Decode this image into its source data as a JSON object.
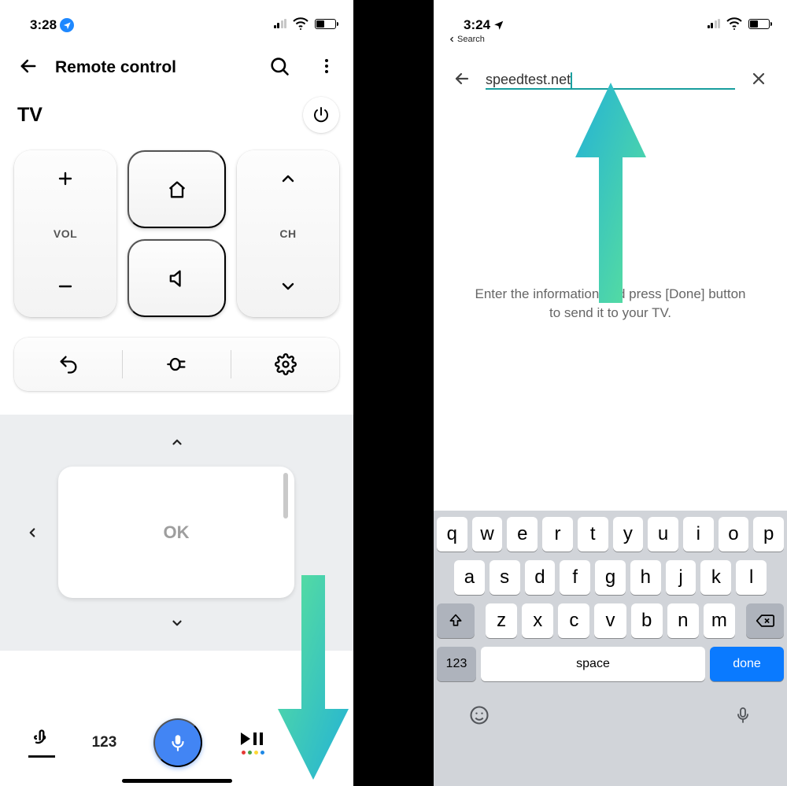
{
  "left": {
    "status_time": "3:28",
    "header_title": "Remote control",
    "device_name": "TV",
    "vol_label": "VOL",
    "ch_label": "CH",
    "ok_label": "OK",
    "bottombar": {
      "numeric_label": "123"
    }
  },
  "right": {
    "status_time": "3:24",
    "breadcrumb_label": "Search",
    "search_value": "speedtest.net",
    "help_text_line1": "Enter the information and press [Done] button",
    "help_text_line2": "to send it to your TV.",
    "keyboard": {
      "row1": [
        "q",
        "w",
        "e",
        "r",
        "t",
        "y",
        "u",
        "i",
        "o",
        "p"
      ],
      "row2": [
        "a",
        "s",
        "d",
        "f",
        "g",
        "h",
        "j",
        "k",
        "l"
      ],
      "row3": [
        "z",
        "x",
        "c",
        "v",
        "b",
        "n",
        "m"
      ],
      "num_label": "123",
      "space_label": "space",
      "done_label": "done"
    }
  }
}
